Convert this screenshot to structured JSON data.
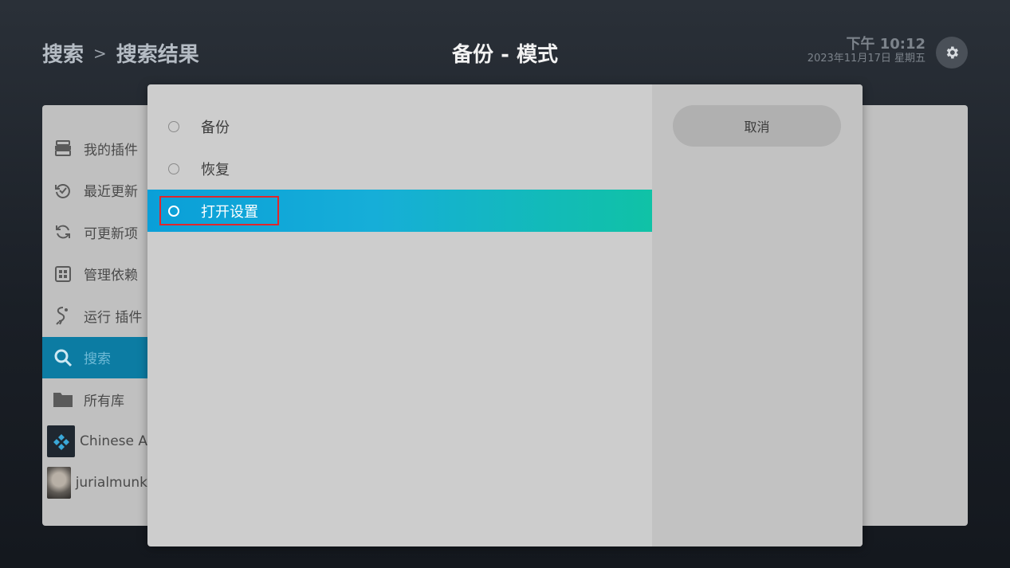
{
  "header": {
    "breadcrumb": {
      "root": "搜索",
      "separator": ">",
      "current": "搜索结果"
    },
    "title": "备份 - 模式",
    "clock": {
      "time": "下午 10:12",
      "date": "2023年11月17日 星期五"
    },
    "settings_icon": "gear-icon"
  },
  "sidebar": {
    "items": [
      {
        "label": "我的插件",
        "icon": "addon-box-icon"
      },
      {
        "label": "最近更新",
        "icon": "recent-update-icon"
      },
      {
        "label": "可更新项",
        "icon": "update-refresh-icon"
      },
      {
        "label": "管理依赖",
        "icon": "dependency-icon"
      },
      {
        "label": "运行 插件",
        "icon": "run-addon-icon"
      },
      {
        "label": "搜索",
        "icon": "search-icon",
        "active": true
      },
      {
        "label": "所有库",
        "icon": "folder-icon"
      },
      {
        "label": "Chinese A",
        "icon": "repo-thumbnail"
      },
      {
        "label": "jurialmunk",
        "icon": "repo-avatar"
      }
    ]
  },
  "dialog": {
    "options": [
      {
        "label": "备份",
        "selected": false
      },
      {
        "label": "恢复",
        "selected": false
      },
      {
        "label": "打开设置",
        "selected": true
      }
    ],
    "cancel_label": "取消"
  },
  "colors": {
    "selection_gradient_start": "#0a9fd8",
    "selection_gradient_end": "#10c2a6",
    "focus_outline": "#e1262b",
    "sidebar_active": "#0c7ca3"
  }
}
